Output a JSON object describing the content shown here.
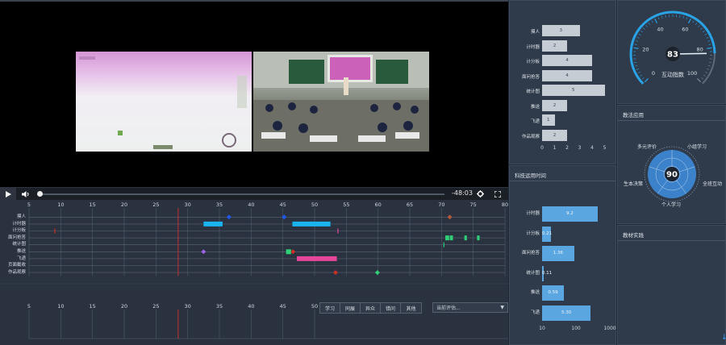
{
  "player": {
    "time_remaining": "-48:03",
    "progress": 0.0
  },
  "timeline": {
    "ticks": [
      "5",
      "10",
      "15",
      "20",
      "25",
      "30",
      "35",
      "40",
      "45",
      "50",
      "55",
      "60",
      "65",
      "70",
      "75",
      "80"
    ],
    "lower_ticks": [
      "5",
      "10",
      "15",
      "20",
      "25",
      "30",
      "35",
      "40",
      "45",
      "50"
    ],
    "rows": [
      "摸人",
      "计时器",
      "计分板",
      "面问抢答",
      "统计图",
      "推送",
      "飞递",
      "页面截收",
      "作品观察"
    ],
    "filters": [
      "学习",
      "同展",
      "异众",
      "错问",
      "其他"
    ],
    "eval_select": "当前评估...",
    "colors": {
      "cyan": "#19b3ef",
      "blue": "#2058e8",
      "pink": "#e7479a",
      "green": "#2fcf76",
      "purple": "#9a66e0",
      "red": "#c8312a",
      "brown": "#b05a3a"
    }
  },
  "bar_chart_1": {
    "labels": [
      "摸人",
      "计时器",
      "计分板",
      "面问抢答",
      "统计图",
      "推送",
      "飞递",
      "作品观察"
    ],
    "values": [
      3,
      2,
      4,
      4,
      5,
      2,
      1,
      2
    ],
    "value_labels": [
      "3",
      "2",
      "4",
      "4",
      "5",
      "2",
      "1",
      "2"
    ],
    "ticks": [
      "0",
      "1",
      "2",
      "3",
      "4",
      "5"
    ],
    "color": "#c5ccd4"
  },
  "bar_chart_2": {
    "title": "科技运用时间",
    "labels": [
      "计时器",
      "计分板",
      "面问抢答",
      "统计图",
      "推送",
      "飞递"
    ],
    "values": [
      9.2,
      0.21,
      1.36,
      0.11,
      0.59,
      5.3
    ],
    "value_labels": [
      "9.2",
      "0.21",
      "1.36",
      "0.11",
      "0.59",
      "5.30"
    ],
    "ticks": [
      "10",
      "100",
      "1000"
    ],
    "color": "#5aa6e0"
  },
  "gauge": {
    "value": "83",
    "label": "互动指数",
    "ticks": [
      "0",
      "20",
      "40",
      "60",
      "80",
      "100"
    ],
    "color": "#2aa3e6"
  },
  "radar": {
    "title": "教法应用",
    "value": "90",
    "labels": [
      "多元评价",
      "小组学习",
      "全班互动",
      "个人学习",
      "生本决策"
    ],
    "color": "#3e8fe0"
  },
  "practice": {
    "title": "教材实践"
  },
  "chart_data": [
    {
      "type": "bar",
      "orientation": "horizontal",
      "categories": [
        "摸人",
        "计时器",
        "计分板",
        "面问抢答",
        "统计图",
        "推送",
        "飞递",
        "作品观察"
      ],
      "values": [
        3,
        2,
        4,
        4,
        5,
        2,
        1,
        2
      ],
      "xlim": [
        0,
        5
      ]
    },
    {
      "type": "bar",
      "orientation": "horizontal",
      "title": "科技运用时间",
      "categories": [
        "计时器",
        "计分板",
        "面问抢答",
        "统计图",
        "推送",
        "飞递"
      ],
      "values": [
        9.2,
        0.21,
        1.36,
        0.11,
        0.59,
        5.3
      ],
      "xscale": "log"
    }
  ]
}
